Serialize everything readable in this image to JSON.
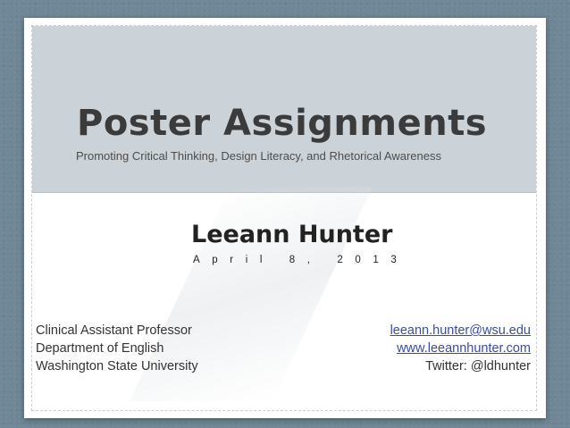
{
  "slide": {
    "title": "Poster Assignments",
    "subtitle": "Promoting Critical Thinking, Design Literacy, and Rhetorical Awareness",
    "presenter": "Leeann Hunter",
    "date": "April 8, 2013",
    "left_info": [
      "Clinical Assistant Professor",
      "Department of English",
      "Washington State University"
    ],
    "email": "leeann.hunter@wsu.edu",
    "website": "www.leeannhunter.com",
    "twitter": "Twitter: @ldhunter"
  },
  "colors": {
    "background": "#6f8796",
    "header": "#ccd3d8",
    "link": "#3a4d9c"
  }
}
